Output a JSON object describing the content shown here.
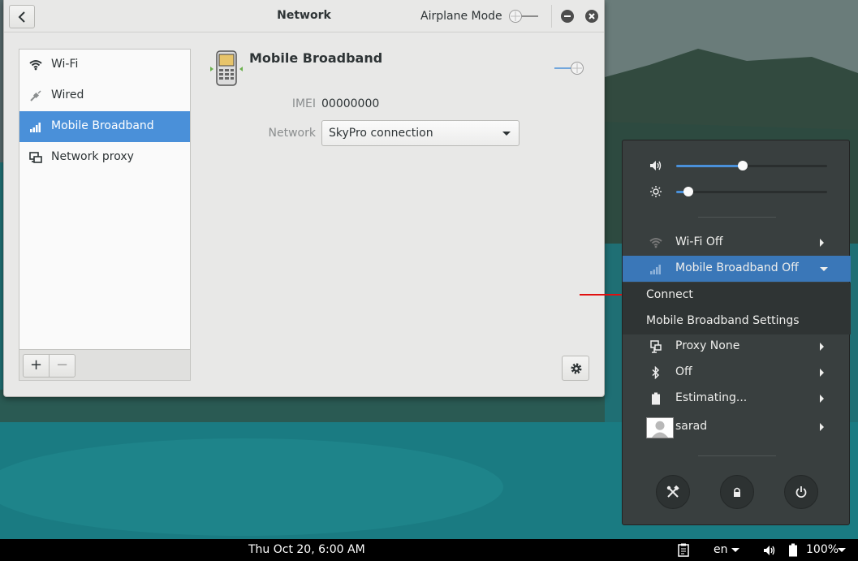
{
  "window": {
    "title": "Network",
    "airplane_mode_label": "Airplane Mode"
  },
  "sidebar": {
    "items": [
      {
        "label": "Wi-Fi",
        "icon": "wifi-icon"
      },
      {
        "label": "Wired",
        "icon": "wired-icon"
      },
      {
        "label": "Mobile Broadband",
        "icon": "signal-bars-icon",
        "selected": true
      },
      {
        "label": "Network proxy",
        "icon": "network-proxy-icon"
      }
    ],
    "add_label": "+",
    "remove_label": "−"
  },
  "device": {
    "title": "Mobile Broadband",
    "imei_label": "IMEI",
    "imei_value": "00000000",
    "network_label": "Network",
    "network_value": "SkyPro connection",
    "enabled": false
  },
  "system_menu": {
    "volume_level": 0.44,
    "brightness_level": 0.08,
    "items": [
      {
        "label": "Wi-Fi Off",
        "icon": "wifi-icon"
      },
      {
        "label": "Mobile Broadband Off",
        "icon": "signal-bars-icon",
        "expanded": true
      },
      {
        "label": "Proxy None",
        "icon": "network-proxy-icon"
      },
      {
        "label": "Off",
        "icon": "bluetooth-icon"
      },
      {
        "label": "Estimating...",
        "icon": "battery-icon"
      },
      {
        "label": "sarad",
        "icon": "avatar"
      }
    ],
    "submenu": {
      "connect_label": "Connect",
      "settings_label": "Mobile Broadband Settings"
    },
    "actions": [
      "settings-icon",
      "lock-icon",
      "power-icon"
    ],
    "accent_color": "#3a77b8"
  },
  "panel": {
    "clock": "Thu Oct 20,  6:00 AM",
    "keyboard_layout": "en",
    "battery_percent": "100%"
  }
}
